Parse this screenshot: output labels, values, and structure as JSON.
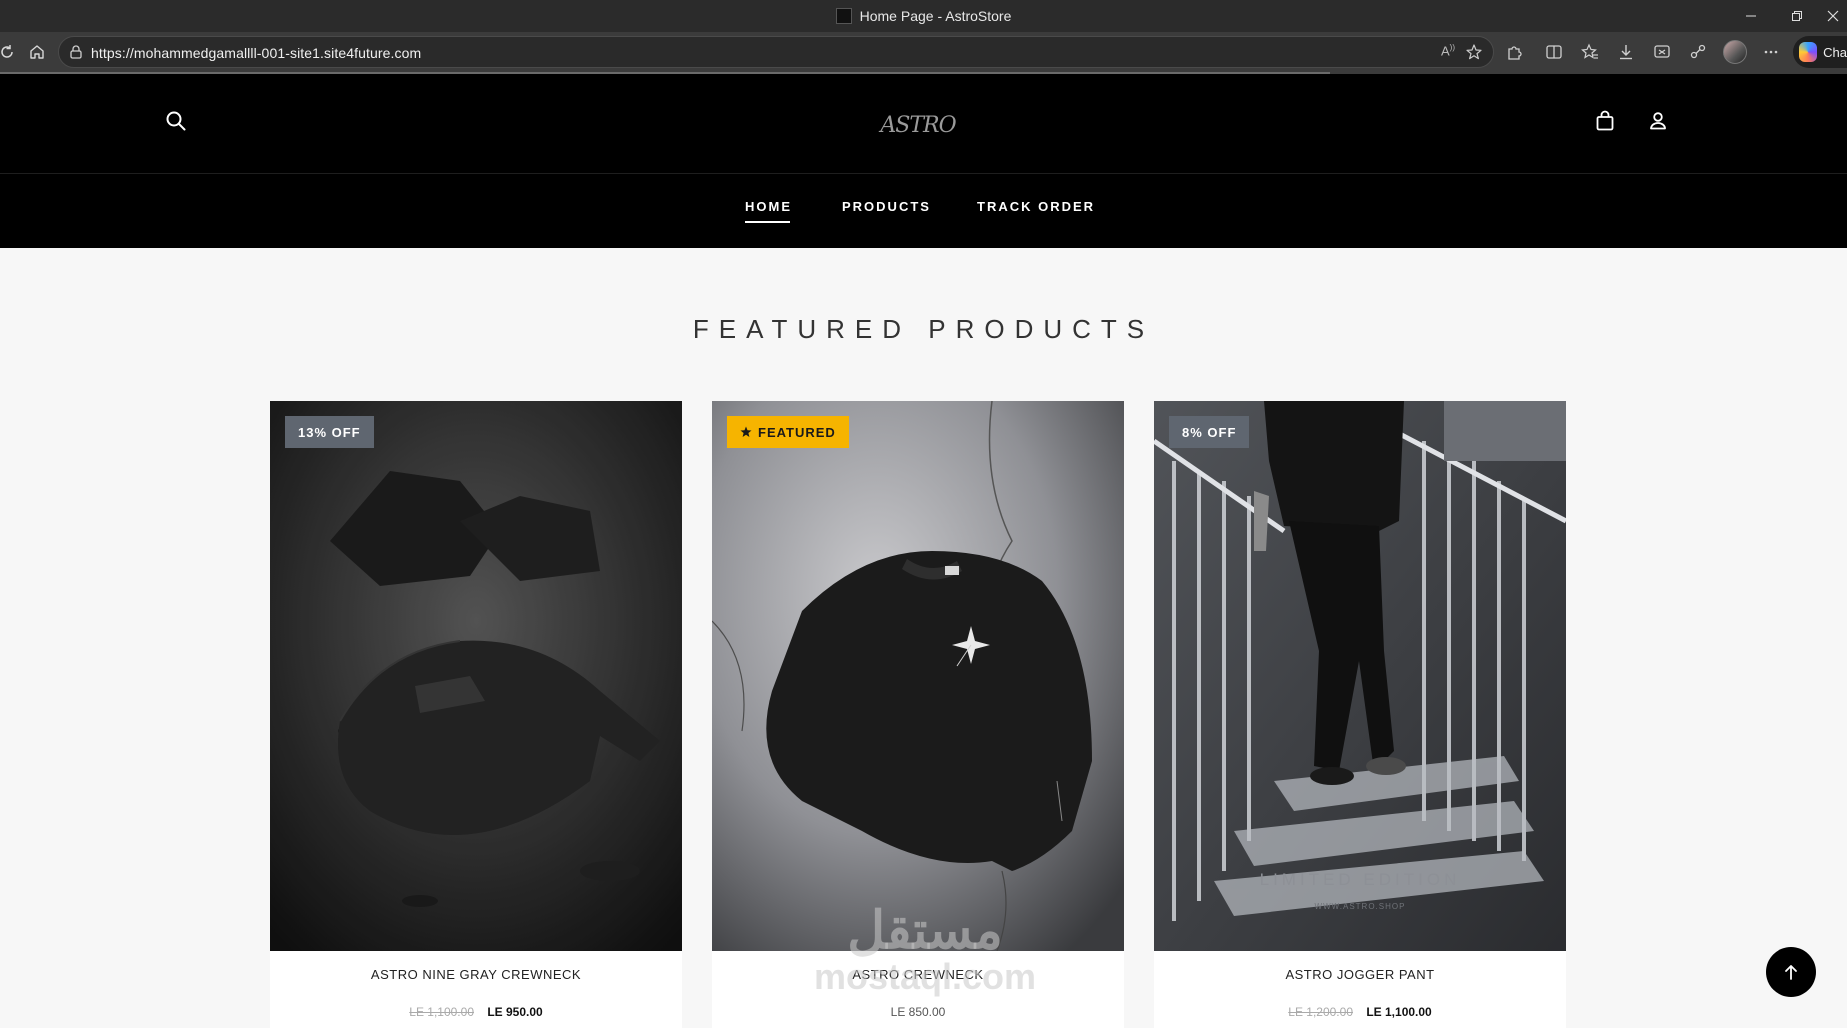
{
  "browser": {
    "tab_title": "Home Page - AstroStore",
    "url": "https://mohammedgamallll-001-site1.site4future.com",
    "read_aloud": "A",
    "copilot_label": "Cha",
    "load_progress": 0.72
  },
  "header": {
    "brand": "ASTRO",
    "nav": [
      {
        "label": "HOME",
        "active": true
      },
      {
        "label": "PRODUCTS",
        "active": false
      },
      {
        "label": "TRACK ORDER",
        "active": false
      }
    ]
  },
  "featured": {
    "title": "FEATURED PRODUCTS",
    "products": [
      {
        "badge": "13% OFF",
        "badge_type": "discount",
        "name": "ASTRO NINE GRAY CREWNECK",
        "old_price": "LE 1,100.00",
        "price": "LE 950.00"
      },
      {
        "badge": "FEATURED",
        "badge_type": "featured",
        "name": "ASTRO CREWNECK",
        "old_price": "",
        "price": "LE 850.00"
      },
      {
        "badge": "8% OFF",
        "badge_type": "discount",
        "name": "ASTRO JOGGER PANT",
        "old_price": "LE 1,200.00",
        "price": "LE 1,100.00"
      }
    ],
    "photo_text": "LIMITED EDITION",
    "photo_subtext": "WWW.ASTRO.SHOP"
  },
  "watermark": {
    "arabic": "مستقل",
    "latin": "mostaql.com"
  }
}
